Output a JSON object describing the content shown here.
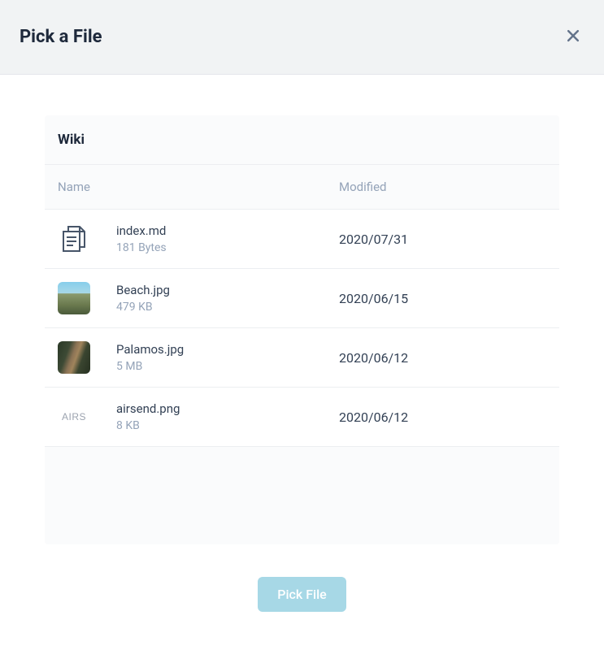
{
  "modal": {
    "title": "Pick a File",
    "breadcrumb": "Wiki",
    "columns": {
      "name": "Name",
      "modified": "Modified"
    }
  },
  "files": [
    {
      "name": "index.md",
      "size": "181 Bytes",
      "modified": "2020/07/31",
      "icon": "document"
    },
    {
      "name": "Beach.jpg",
      "size": "479 KB",
      "modified": "2020/06/15",
      "icon": "thumb-beach"
    },
    {
      "name": "Palamos.jpg",
      "size": "5 MB",
      "modified": "2020/06/12",
      "icon": "thumb-palamos"
    },
    {
      "name": "airsend.png",
      "size": "8 KB",
      "modified": "2020/06/12",
      "icon": "thumb-airs",
      "thumb_text": "AIRS"
    }
  ],
  "footer": {
    "pick_label": "Pick File"
  }
}
